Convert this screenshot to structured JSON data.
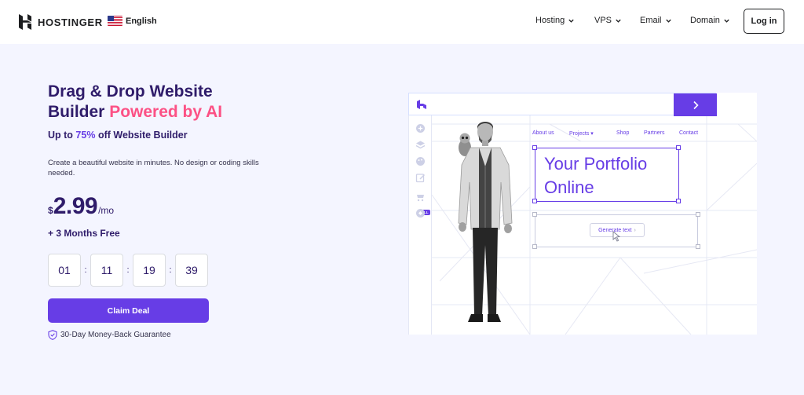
{
  "header": {
    "brand": "HOSTINGER",
    "language": "English",
    "nav": [
      {
        "label": "Hosting"
      },
      {
        "label": "VPS"
      },
      {
        "label": "Email"
      },
      {
        "label": "Domain"
      }
    ],
    "login_label": "Log in"
  },
  "hero": {
    "title_main": "Drag & Drop Website Builder",
    "title_accent": "Powered by AI",
    "subtitle_prefix": "Up to",
    "subtitle_pct": "75%",
    "subtitle_suffix": "off Website Builder",
    "description": "Create a beautiful website in minutes. No design or coding skills needed.",
    "price": {
      "currency": "$",
      "amount": "2.99",
      "period": "/mo"
    },
    "bonus": "+ 3 Months Free",
    "countdown": [
      "01",
      "11",
      "19",
      "39"
    ],
    "cta_label": "Claim Deal",
    "guarantee": "30-Day Money-Back Guarantee"
  },
  "illustration": {
    "nav_items": [
      "About us",
      "Projects ▾",
      "Shop",
      "Partners",
      "Contact"
    ],
    "headline_line1": "Your Portfolio",
    "headline_line2": "Online",
    "generate_label": "Generate text",
    "sell_badge": "SELL"
  },
  "colors": {
    "primary": "#673de6",
    "accent_pink": "#fc5185",
    "navy": "#2f1c6a",
    "hero_bg": "#f4f5ff"
  }
}
